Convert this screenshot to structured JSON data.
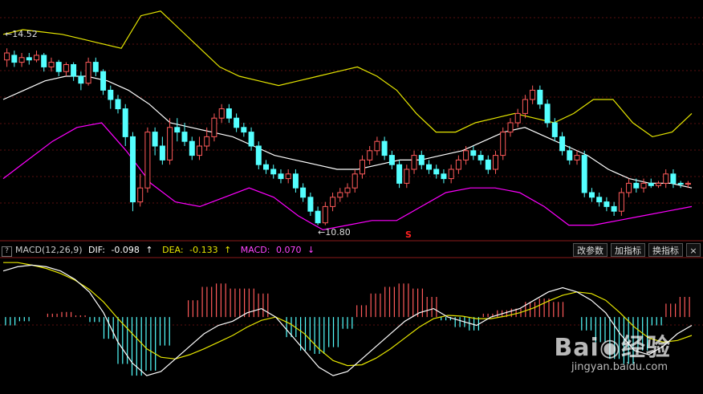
{
  "indicator_bar": {
    "help_glyph": "?",
    "macd_title": "MACD(12,26,9)",
    "dif_label": "DIF:",
    "dif_value": "-0.098",
    "dif_arrow": "↑",
    "dea_label": "DEA:",
    "dea_value": "-0.133",
    "dea_arrow": "↑",
    "macd_label": "MACD:",
    "macd_value": "0.070",
    "macd_arrow": "↓"
  },
  "buttons": {
    "change_params": "改参数",
    "add_indicator": "加指标",
    "switch_indicator": "换指标",
    "close_glyph": "×"
  },
  "price_labels": {
    "high": "14.52",
    "low": "10.80",
    "sell_signal": "S"
  },
  "watermark": {
    "brand": "Bai",
    "brand_suffix": "经验",
    "url": "jingyan.baidu.com"
  },
  "colors": {
    "background": "#000000",
    "up_candle": "#ff5a5a",
    "down_candle": "#54ffff",
    "boll_upper": "#e6e600",
    "boll_mid": "#ffffff",
    "boll_lower": "#ff00ff",
    "dif_line": "#ffffff",
    "dea_line": "#e6e600",
    "macd_positive": "#ff5a5a",
    "macd_negative": "#54ffff",
    "signal": "#ff2020"
  },
  "chart_data": [
    {
      "type": "candlestick",
      "title": "",
      "indicator": "BOLL",
      "ylim": [
        10.5,
        15.5
      ],
      "max_label": 14.52,
      "min_label": 10.8,
      "candles": [
        [
          14.35,
          14.5,
          14.6,
          14.2
        ],
        [
          14.45,
          14.3,
          14.55,
          14.2
        ],
        [
          14.3,
          14.4,
          14.5,
          14.2
        ],
        [
          14.4,
          14.35,
          14.5,
          14.25
        ],
        [
          14.35,
          14.45,
          14.55,
          14.3
        ],
        [
          14.45,
          14.2,
          14.5,
          14.1
        ],
        [
          14.2,
          14.3,
          14.4,
          14.1
        ],
        [
          14.3,
          14.1,
          14.35,
          14.0
        ],
        [
          14.1,
          14.25,
          14.3,
          14.0
        ],
        [
          14.25,
          14.0,
          14.3,
          13.9
        ],
        [
          14.0,
          13.85,
          14.1,
          13.7
        ],
        [
          13.85,
          14.3,
          14.4,
          13.8
        ],
        [
          14.3,
          14.1,
          14.4,
          14.0
        ],
        [
          14.1,
          13.7,
          14.15,
          13.6
        ],
        [
          13.7,
          13.5,
          13.8,
          13.3
        ],
        [
          13.5,
          13.3,
          13.6,
          13.2
        ],
        [
          13.3,
          12.7,
          13.4,
          12.5
        ],
        [
          12.7,
          11.3,
          12.8,
          11.1
        ],
        [
          11.3,
          11.6,
          11.9,
          11.2
        ],
        [
          11.6,
          12.8,
          12.9,
          11.5
        ],
        [
          12.8,
          12.5,
          12.9,
          12.3
        ],
        [
          12.5,
          12.2,
          12.7,
          12.1
        ],
        [
          12.2,
          12.9,
          13.1,
          12.1
        ],
        [
          12.9,
          12.8,
          13.1,
          12.6
        ],
        [
          12.8,
          12.6,
          13.0,
          12.5
        ],
        [
          12.6,
          12.3,
          12.7,
          12.2
        ],
        [
          12.3,
          12.5,
          12.7,
          12.2
        ],
        [
          12.5,
          12.7,
          12.9,
          12.4
        ],
        [
          12.7,
          13.1,
          13.2,
          12.6
        ],
        [
          13.1,
          13.3,
          13.4,
          13.0
        ],
        [
          13.3,
          13.1,
          13.4,
          13.0
        ],
        [
          13.1,
          12.9,
          13.2,
          12.8
        ],
        [
          12.9,
          12.8,
          13.0,
          12.7
        ],
        [
          12.8,
          12.5,
          12.9,
          12.4
        ],
        [
          12.5,
          12.1,
          12.6,
          12.0
        ],
        [
          12.1,
          12.0,
          12.2,
          11.9
        ],
        [
          12.0,
          11.9,
          12.1,
          11.8
        ],
        [
          11.9,
          11.8,
          12.0,
          11.7
        ],
        [
          11.8,
          11.9,
          12.0,
          11.7
        ],
        [
          11.9,
          11.6,
          12.0,
          11.5
        ],
        [
          11.6,
          11.4,
          11.7,
          11.3
        ],
        [
          11.4,
          11.1,
          11.5,
          11.0
        ],
        [
          11.1,
          10.85,
          11.2,
          10.8
        ],
        [
          10.85,
          11.2,
          11.3,
          10.8
        ],
        [
          11.2,
          11.4,
          11.5,
          11.1
        ],
        [
          11.4,
          11.5,
          11.6,
          11.3
        ],
        [
          11.5,
          11.6,
          11.7,
          11.4
        ],
        [
          11.6,
          11.9,
          12.0,
          11.5
        ],
        [
          11.9,
          12.2,
          12.3,
          11.8
        ],
        [
          12.2,
          12.4,
          12.5,
          12.1
        ],
        [
          12.4,
          12.6,
          12.7,
          12.3
        ],
        [
          12.6,
          12.3,
          12.7,
          12.2
        ],
        [
          12.3,
          12.1,
          12.4,
          12.0
        ],
        [
          12.1,
          11.7,
          12.2,
          11.6
        ],
        [
          11.7,
          12.0,
          12.1,
          11.6
        ],
        [
          12.0,
          12.3,
          12.4,
          11.9
        ],
        [
          12.3,
          12.1,
          12.4,
          12.0
        ],
        [
          12.1,
          12.0,
          12.2,
          11.9
        ],
        [
          12.0,
          11.9,
          12.1,
          11.8
        ],
        [
          11.9,
          11.8,
          12.0,
          11.7
        ],
        [
          11.8,
          12.0,
          12.1,
          11.7
        ],
        [
          12.0,
          12.2,
          12.3,
          11.9
        ],
        [
          12.2,
          12.4,
          12.5,
          12.1
        ],
        [
          12.4,
          12.3,
          12.5,
          12.2
        ],
        [
          12.3,
          12.2,
          12.4,
          12.1
        ],
        [
          12.2,
          12.0,
          12.3,
          11.9
        ],
        [
          12.0,
          12.3,
          12.4,
          11.9
        ],
        [
          12.3,
          12.8,
          12.9,
          12.2
        ],
        [
          12.8,
          13.0,
          13.1,
          12.7
        ],
        [
          13.0,
          13.2,
          13.3,
          12.9
        ],
        [
          13.2,
          13.5,
          13.6,
          13.1
        ],
        [
          13.5,
          13.7,
          13.8,
          13.4
        ],
        [
          13.7,
          13.4,
          13.8,
          13.3
        ],
        [
          13.4,
          13.0,
          13.5,
          12.9
        ],
        [
          13.0,
          12.7,
          13.1,
          12.6
        ],
        [
          12.7,
          12.4,
          12.8,
          12.3
        ],
        [
          12.4,
          12.2,
          12.5,
          12.1
        ],
        [
          12.2,
          12.3,
          12.4,
          12.1
        ],
        [
          12.3,
          11.5,
          12.4,
          11.4
        ],
        [
          11.5,
          11.4,
          11.6,
          11.3
        ],
        [
          11.4,
          11.3,
          11.5,
          11.2
        ],
        [
          11.3,
          11.2,
          11.4,
          11.1
        ],
        [
          11.2,
          11.1,
          11.3,
          11.0
        ],
        [
          11.1,
          11.5,
          11.6,
          11.0
        ],
        [
          11.5,
          11.7,
          11.8,
          11.4
        ],
        [
          11.7,
          11.6,
          11.8,
          11.5
        ],
        [
          11.6,
          11.7,
          11.8,
          11.5
        ],
        [
          11.7,
          11.65,
          11.8,
          11.6
        ],
        [
          11.65,
          11.7,
          11.75,
          11.6
        ],
        [
          11.7,
          11.9,
          12.0,
          11.6
        ],
        [
          11.9,
          11.7,
          12.0,
          11.6
        ],
        [
          11.7,
          11.68,
          11.75,
          11.6
        ],
        [
          11.68,
          11.7,
          11.75,
          11.6
        ]
      ],
      "boll_upper": [
        14.9,
        15.0,
        14.95,
        14.9,
        14.8,
        14.7,
        14.6,
        15.3,
        15.4,
        15.0,
        14.6,
        14.2,
        14.0,
        13.9,
        13.8,
        13.9,
        14.0,
        14.1,
        14.2,
        14.0,
        13.7,
        13.2,
        12.8,
        12.8,
        13.0,
        13.1,
        13.2,
        13.1,
        13.0,
        13.2,
        13.5,
        13.5,
        13.0,
        12.7,
        12.8,
        13.2
      ],
      "boll_mid": [
        13.5,
        13.7,
        13.9,
        14.0,
        14.0,
        13.9,
        13.7,
        13.4,
        13.0,
        12.9,
        12.8,
        12.7,
        12.5,
        12.3,
        12.2,
        12.1,
        12.0,
        12.0,
        12.1,
        12.2,
        12.2,
        12.3,
        12.4,
        12.6,
        12.8,
        12.9,
        12.7,
        12.5,
        12.3,
        12.0,
        11.8,
        11.7,
        11.7,
        11.6
      ],
      "boll_lower": [
        11.8,
        12.2,
        12.6,
        12.9,
        13.0,
        12.4,
        11.7,
        11.3,
        11.2,
        11.4,
        11.6,
        11.4,
        11.0,
        10.7,
        10.8,
        10.9,
        10.9,
        11.2,
        11.5,
        11.6,
        11.6,
        11.5,
        11.2,
        10.8,
        10.8,
        10.9,
        11.0,
        11.1,
        11.2
      ]
    },
    {
      "type": "bar+line",
      "title": "MACD(12,26,9)",
      "ylim": [
        -0.9,
        0.7
      ],
      "series": [
        {
          "name": "DIF",
          "values": [
            0.55,
            0.6,
            0.62,
            0.6,
            0.55,
            0.45,
            0.3,
            0.05,
            -0.3,
            -0.55,
            -0.7,
            -0.65,
            -0.5,
            -0.35,
            -0.2,
            -0.1,
            -0.05,
            0.05,
            0.1,
            0.0,
            -0.2,
            -0.4,
            -0.6,
            -0.7,
            -0.65,
            -0.5,
            -0.35,
            -0.2,
            -0.05,
            0.05,
            0.1,
            0.0,
            -0.05,
            -0.1,
            0.0,
            0.05,
            0.1,
            0.2,
            0.3,
            0.35,
            0.3,
            0.2,
            0.05,
            -0.2,
            -0.4,
            -0.45,
            -0.35,
            -0.2,
            -0.1
          ]
        },
        {
          "name": "DEA",
          "values": [
            0.65,
            0.65,
            0.62,
            0.58,
            0.52,
            0.44,
            0.33,
            0.18,
            -0.02,
            -0.2,
            -0.38,
            -0.48,
            -0.5,
            -0.45,
            -0.38,
            -0.3,
            -0.22,
            -0.12,
            -0.04,
            0.0,
            -0.08,
            -0.2,
            -0.38,
            -0.52,
            -0.58,
            -0.57,
            -0.49,
            -0.38,
            -0.25,
            -0.12,
            -0.02,
            0.02,
            0.01,
            -0.02,
            -0.02,
            0.01,
            0.05,
            0.11,
            0.19,
            0.26,
            0.3,
            0.28,
            0.2,
            0.05,
            -0.12,
            -0.25,
            -0.3,
            -0.28,
            -0.22
          ]
        },
        {
          "name": "MACD",
          "values": [
            -0.1,
            -0.05,
            0.0,
            0.04,
            0.06,
            0.02,
            -0.06,
            -0.26,
            -0.56,
            -0.7,
            -0.64,
            -0.34,
            0.0,
            0.2,
            0.36,
            0.4,
            0.34,
            0.34,
            0.28,
            0.0,
            -0.24,
            -0.4,
            -0.44,
            -0.36,
            -0.14,
            0.14,
            0.28,
            0.36,
            0.4,
            0.34,
            0.24,
            -0.04,
            -0.12,
            -0.16,
            0.04,
            0.08,
            0.1,
            0.18,
            0.22,
            0.18,
            0.0,
            -0.16,
            -0.3,
            -0.5,
            -0.56,
            -0.4,
            -0.1,
            0.16,
            0.24
          ]
        }
      ]
    }
  ]
}
